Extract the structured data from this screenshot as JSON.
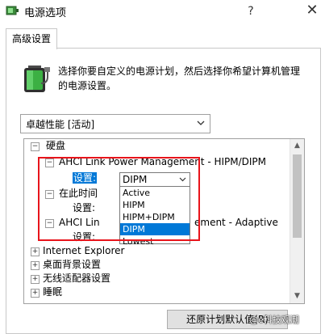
{
  "window": {
    "title": "电源选项",
    "help_label": "?",
    "close_label": "✕"
  },
  "tab": {
    "label": "高级设置"
  },
  "description": {
    "line1": "选择你要自定义的电源计划，然后选择你希望计算机管理",
    "line2": "的电源设置。"
  },
  "plan_select": {
    "value": "卓越性能 [活动]"
  },
  "tree": {
    "items": [
      {
        "label": "硬盘",
        "toggle": "⊟"
      },
      {
        "label": "AHCI Link Power Management - HIPM/DIPM",
        "toggle": "⊟"
      },
      {
        "label": "设置:"
      },
      {
        "label": "在此时间",
        "toggle": "⊟"
      },
      {
        "label": "设置:"
      },
      {
        "label": "AHCI Lin",
        "suffix": "ement - Adaptive",
        "toggle": "⊟"
      },
      {
        "label": "设置:"
      },
      {
        "label": "Internet Explorer",
        "toggle": "⊞"
      },
      {
        "label": "桌面背景设置",
        "toggle": "⊞"
      },
      {
        "label": "无线适配器设置",
        "toggle": "⊞"
      },
      {
        "label": "睡眠",
        "toggle": "⊞"
      }
    ],
    "setting_value": "DIPM",
    "dropdown_options": [
      "Active",
      "HIPM",
      "HIPM+DIPM",
      "DIPM",
      "Lowest"
    ],
    "selected_option": "DIPM"
  },
  "buttons": {
    "restore": "还原计划默认值(R)"
  },
  "watermark": "@e科技观潮",
  "colors": {
    "accent": "#0078d7",
    "highlight_border": "#e8141b"
  },
  "icons": [
    "power-options-icon",
    "battery-plug-icon",
    "chevron-down-icon",
    "expand-icon",
    "collapse-icon"
  ]
}
